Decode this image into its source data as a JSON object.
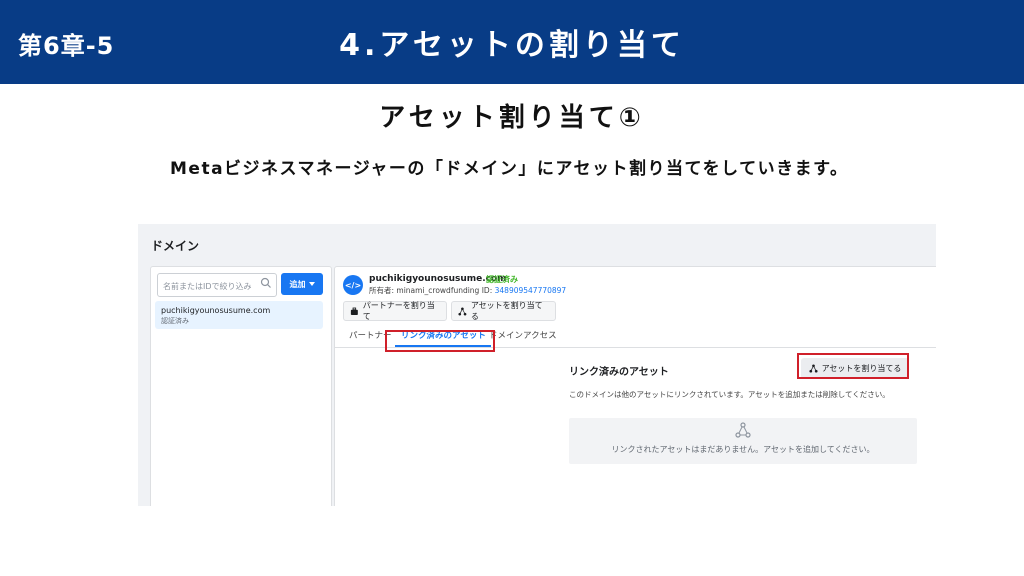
{
  "slide": {
    "chapter": "第6章-5",
    "title": "4.アセットの割り当て",
    "subtitle": "アセット割り当て①",
    "description": "Metaビジネスマネージャーの「ドメイン」にアセット割り当てをしていきます。"
  },
  "screen": {
    "title": "ドメイン",
    "search": {
      "placeholder": "名前またはIDで絞り込み"
    },
    "add_button": "追加",
    "domain_list": [
      {
        "name": "puchikigyounosusume.com",
        "status": "認証済み"
      }
    ],
    "detail": {
      "domain": "puchikigyounosusume.com",
      "verified": "認証済み",
      "owner_label": "所有者: minami_crowdfunding",
      "id_label": "ID:",
      "id_value": "348909547770897",
      "partner_button": "パートナーを割り当て",
      "asset_button": "アセットを割り当てる",
      "tabs": [
        "パートナー",
        "リンク済みのアセット",
        "ドメインアクセス"
      ],
      "active_tab": "リンク済みのアセット",
      "section_title": "リンク済みのアセット",
      "assign_button": "アセットを割り当てる",
      "section_desc": "このドメインは他のアセットにリンクされています。アセットを追加または削除してください。",
      "empty_text": "リンクされたアセットはまだありません。アセットを追加してください。"
    }
  },
  "colors": {
    "header_bg": "#083c86",
    "primary": "#1877f2",
    "highlight": "#d0202a",
    "verified": "#42b72a"
  }
}
